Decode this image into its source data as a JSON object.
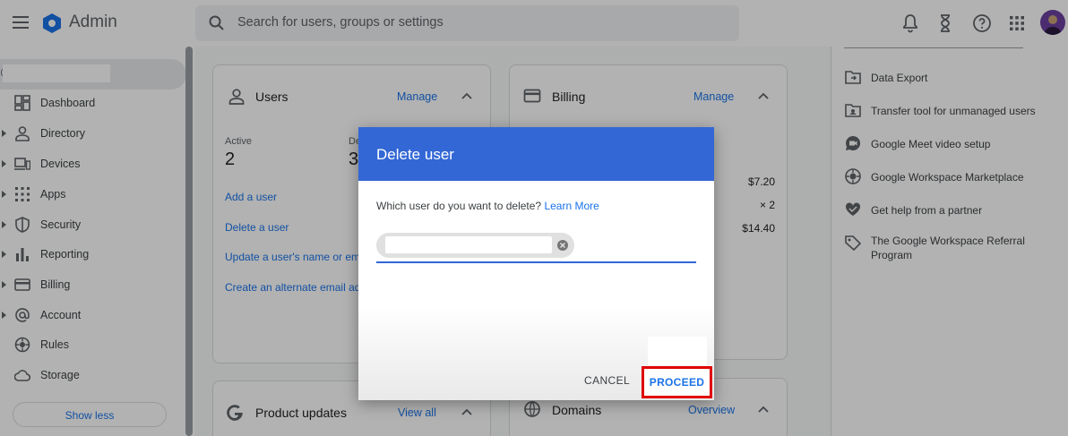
{
  "topbar": {
    "brand": "Admin",
    "search_placeholder": "Search for users, groups or settings"
  },
  "sidebar": {
    "account_prefix": "@",
    "items": [
      {
        "label": "Dashboard",
        "icon": "dashboard-icon"
      },
      {
        "label": "Directory",
        "icon": "person-icon"
      },
      {
        "label": "Devices",
        "icon": "devices-icon"
      },
      {
        "label": "Apps",
        "icon": "apps-grid-icon"
      },
      {
        "label": "Security",
        "icon": "shield-icon"
      },
      {
        "label": "Reporting",
        "icon": "bar-chart-icon"
      },
      {
        "label": "Billing",
        "icon": "credit-card-icon"
      },
      {
        "label": "Account",
        "icon": "at-sign-icon"
      },
      {
        "label": "Rules",
        "icon": "rules-icon"
      },
      {
        "label": "Storage",
        "icon": "cloud-icon"
      }
    ],
    "show_less": "Show less"
  },
  "users_card": {
    "title": "Users",
    "manage": "Manage",
    "active_label": "Active",
    "active_value": "2",
    "deleted_label": "De",
    "deleted_value": "3",
    "actions": [
      "Add a user",
      "Delete a user",
      "Update a user's name or em",
      "Create an alternate email ad"
    ]
  },
  "billing_card": {
    "title": "Billing",
    "manage": "Manage",
    "values": [
      "$7.20",
      "× 2",
      "$14.40"
    ]
  },
  "product_updates": {
    "title": "Product updates",
    "link": "View all"
  },
  "domains": {
    "title": "Domains",
    "link": "Overview"
  },
  "right_panel": {
    "items": [
      {
        "label": "Data Export",
        "icon": "export-icon"
      },
      {
        "label": "Transfer tool for unmanaged users",
        "icon": "transfer-icon"
      },
      {
        "label": "Google Meet video setup",
        "icon": "meet-icon"
      },
      {
        "label": "Google Workspace Marketplace",
        "icon": "marketplace-icon"
      },
      {
        "label": "Get help from a partner",
        "icon": "handshake-icon"
      },
      {
        "label": "The Google Workspace Referral Program",
        "icon": "tag-icon"
      }
    ]
  },
  "dialog": {
    "title": "Delete user",
    "question": "Which user do you want to delete?",
    "learn_more": "Learn More",
    "cancel": "CANCEL",
    "proceed": "PROCEED"
  },
  "colors": {
    "header_blue": "#3367d6",
    "link_blue": "#1a73e8",
    "highlight_red": "#e00000"
  }
}
